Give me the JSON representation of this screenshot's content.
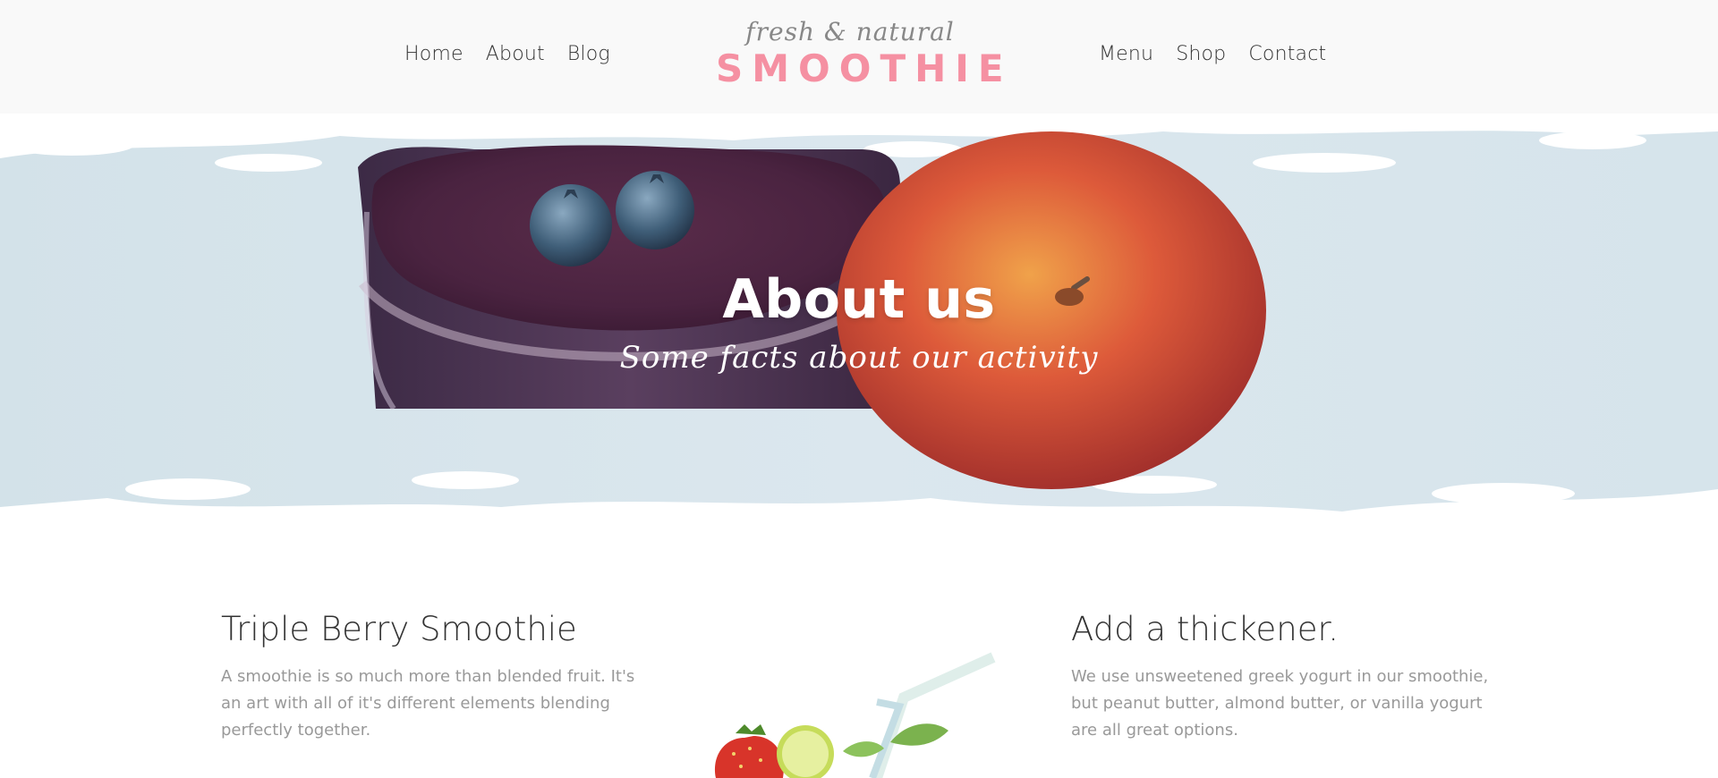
{
  "nav_left": [
    "Home",
    "About",
    "Blog"
  ],
  "nav_right": [
    "Menu",
    "Shop",
    "Contact"
  ],
  "logo": {
    "tagline": "fresh & natural",
    "brand": "SMOOTHIE"
  },
  "hero": {
    "title": "About us",
    "subtitle": "Some facts about our activity"
  },
  "sections": [
    {
      "heading": "Triple Berry Smoothie",
      "body": "A smoothie is so much more than blended fruit. It's an art with all of it's different elements blending perfectly together."
    },
    {
      "heading": "Add a thickener.",
      "body": "We use unsweetened greek yogurt in our smoothie, but peanut butter, almond butter, or vanilla yogurt are all great options."
    }
  ],
  "colors": {
    "brand_pink": "#f590a2",
    "header_bg": "#f9f9f9",
    "hero_band": "#d5e3ea",
    "smoothie": "#4a2a44",
    "apple": "#d9493a",
    "text_muted": "#999999"
  },
  "icons": [
    "smoothie-glass-image",
    "apple-image",
    "blueberry-image",
    "strawberry-image",
    "lime-image",
    "straw-image",
    "mint-leaf-image"
  ]
}
